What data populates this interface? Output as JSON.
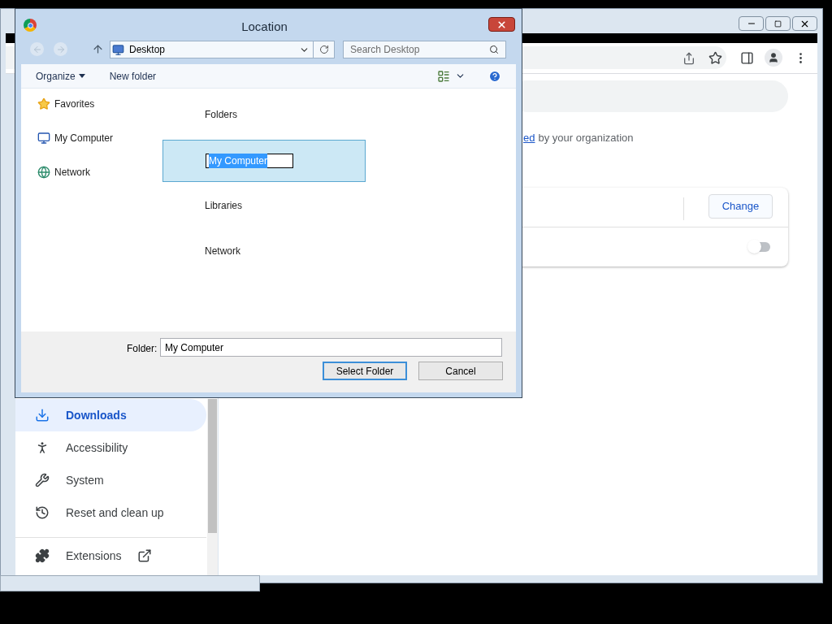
{
  "browser": {
    "org_notice": {
      "link": "ed",
      "text": "by your organization"
    },
    "card": {
      "button": "Change",
      "toggle": {
        "on": false
      }
    },
    "sidebar": {
      "items": [
        {
          "label": "Downloads",
          "selected": true
        },
        {
          "label": "Accessibility",
          "selected": false
        },
        {
          "label": "System",
          "selected": false
        },
        {
          "label": "Reset and clean up",
          "selected": false
        }
      ],
      "footer_item": {
        "label": "Extensions"
      }
    }
  },
  "dialog": {
    "title": "Location",
    "nav": {
      "back": {
        "disabled": true
      },
      "forward": {
        "disabled": true
      }
    },
    "address": "Desktop",
    "search": {
      "placeholder": "Search Desktop"
    },
    "toolbar": {
      "organize": "Organize",
      "new_folder": "New folder"
    },
    "nav_pane": [
      {
        "label": "Favorites"
      },
      {
        "label": "My Computer"
      },
      {
        "label": "Network"
      }
    ],
    "items": [
      {
        "label": "Folders",
        "selected": false
      },
      {
        "label": "My Computer",
        "selected": true
      },
      {
        "label": "Libraries",
        "selected": false
      },
      {
        "label": "Network",
        "selected": false
      }
    ],
    "folder_field": {
      "label": "Folder:",
      "value": "My Computer"
    },
    "buttons": [
      {
        "label": "Select Folder",
        "default": true
      },
      {
        "label": "Cancel",
        "default": false
      }
    ]
  }
}
